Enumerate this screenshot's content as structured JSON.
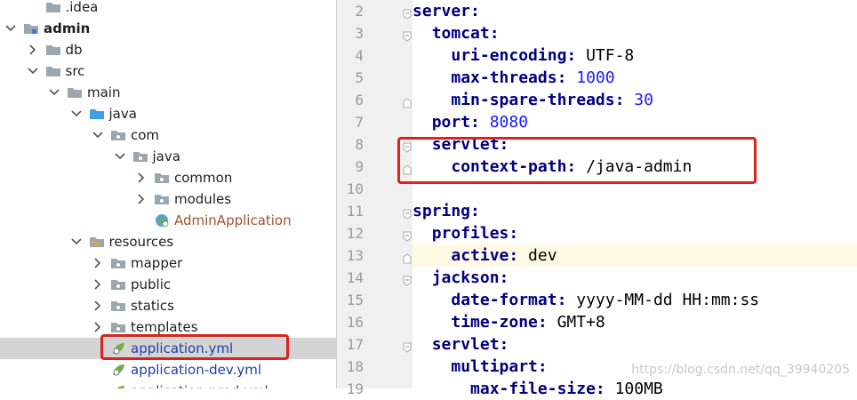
{
  "tree": [
    {
      "id": "idea",
      "label": ".idea",
      "depth": 1,
      "chevron": "none",
      "icon": "folder-gray",
      "style": ""
    },
    {
      "id": "admin",
      "label": "admin",
      "depth": 0,
      "chevron": "down",
      "icon": "module",
      "style": "bold"
    },
    {
      "id": "db",
      "label": "db",
      "depth": 1,
      "chevron": "right",
      "icon": "folder-gray",
      "style": ""
    },
    {
      "id": "src",
      "label": "src",
      "depth": 1,
      "chevron": "down",
      "icon": "folder-gray",
      "style": ""
    },
    {
      "id": "main",
      "label": "main",
      "depth": 2,
      "chevron": "down",
      "icon": "folder-gray",
      "style": ""
    },
    {
      "id": "java-src",
      "label": "java",
      "depth": 3,
      "chevron": "down",
      "icon": "folder-blue",
      "style": ""
    },
    {
      "id": "com",
      "label": "com",
      "depth": 4,
      "chevron": "down",
      "icon": "package",
      "style": ""
    },
    {
      "id": "java-pkg",
      "label": "java",
      "depth": 5,
      "chevron": "down",
      "icon": "package",
      "style": ""
    },
    {
      "id": "common",
      "label": "common",
      "depth": 6,
      "chevron": "right",
      "icon": "package",
      "style": ""
    },
    {
      "id": "modules",
      "label": "modules",
      "depth": 6,
      "chevron": "right",
      "icon": "package",
      "style": ""
    },
    {
      "id": "admin-application",
      "label": "AdminApplication",
      "depth": 6,
      "chevron": "none",
      "icon": "spring-class",
      "style": "orange"
    },
    {
      "id": "resources",
      "label": "resources",
      "depth": 3,
      "chevron": "down",
      "icon": "folder-resources",
      "style": ""
    },
    {
      "id": "mapper",
      "label": "mapper",
      "depth": 4,
      "chevron": "right",
      "icon": "package",
      "style": ""
    },
    {
      "id": "public",
      "label": "public",
      "depth": 4,
      "chevron": "right",
      "icon": "package",
      "style": ""
    },
    {
      "id": "statics",
      "label": "statics",
      "depth": 4,
      "chevron": "right",
      "icon": "package",
      "style": ""
    },
    {
      "id": "templates",
      "label": "templates",
      "depth": 4,
      "chevron": "right",
      "icon": "package",
      "style": ""
    },
    {
      "id": "application-yml",
      "label": "application.yml",
      "depth": 4,
      "chevron": "none",
      "icon": "spring-yml",
      "style": "blue",
      "selected": true
    },
    {
      "id": "application-dev-yml",
      "label": "application-dev.yml",
      "depth": 4,
      "chevron": "none",
      "icon": "spring-yml",
      "style": "blue"
    },
    {
      "id": "application-partial",
      "label": "application-prod.yml",
      "depth": 4,
      "chevron": "none",
      "icon": "spring-yml",
      "style": "blue"
    }
  ],
  "code": [
    {
      "n": "2",
      "indent": 0,
      "key": "server",
      "sep": ":",
      "value": "",
      "vtype": ""
    },
    {
      "n": "3",
      "indent": 1,
      "key": "tomcat",
      "sep": ":",
      "value": "",
      "vtype": ""
    },
    {
      "n": "4",
      "indent": 2,
      "key": "uri-encoding",
      "sep": ":",
      "value": "UTF-8",
      "vtype": "txt"
    },
    {
      "n": "5",
      "indent": 2,
      "key": "max-threads",
      "sep": ":",
      "value": "1000",
      "vtype": "num"
    },
    {
      "n": "6",
      "indent": 2,
      "key": "min-spare-threads",
      "sep": ":",
      "value": "30",
      "vtype": "num"
    },
    {
      "n": "7",
      "indent": 1,
      "key": "port",
      "sep": ":",
      "value": "8080",
      "vtype": "num"
    },
    {
      "n": "8",
      "indent": 1,
      "key": "servlet",
      "sep": ":",
      "value": "",
      "vtype": ""
    },
    {
      "n": "9",
      "indent": 2,
      "key": "context-path",
      "sep": ":",
      "value": "/java-admin",
      "vtype": "txt"
    },
    {
      "n": "10",
      "indent": 0,
      "key": "",
      "sep": "",
      "value": "",
      "vtype": ""
    },
    {
      "n": "11",
      "indent": 0,
      "key": "spring",
      "sep": ":",
      "value": "",
      "vtype": ""
    },
    {
      "n": "12",
      "indent": 1,
      "key": "profiles",
      "sep": ":",
      "value": "",
      "vtype": ""
    },
    {
      "n": "13",
      "indent": 2,
      "key": "active",
      "sep": ":",
      "value": "dev",
      "vtype": "txt",
      "current": true
    },
    {
      "n": "14",
      "indent": 1,
      "key": "jackson",
      "sep": ":",
      "value": "",
      "vtype": ""
    },
    {
      "n": "15",
      "indent": 2,
      "key": "date-format",
      "sep": ":",
      "value": "yyyy-MM-dd HH:mm:ss",
      "vtype": "txt"
    },
    {
      "n": "16",
      "indent": 2,
      "key": "time-zone",
      "sep": ":",
      "value": "GMT+8",
      "vtype": "txt"
    },
    {
      "n": "17",
      "indent": 1,
      "key": "servlet",
      "sep": ":",
      "value": "",
      "vtype": ""
    },
    {
      "n": "18",
      "indent": 2,
      "key": "multipart",
      "sep": ":",
      "value": "",
      "vtype": ""
    },
    {
      "n": "19",
      "indent": 3,
      "key": "max-file-size",
      "sep": ":",
      "value": "100MB",
      "vtype": "txt"
    }
  ],
  "watermark": "https://blog.csdn.net/qq_39940205",
  "colors": {
    "key": "#000080",
    "number": "#1a1aff",
    "highlight": "#e0201a",
    "selection": "#d4d4d4",
    "current_line": "#fffae3"
  }
}
